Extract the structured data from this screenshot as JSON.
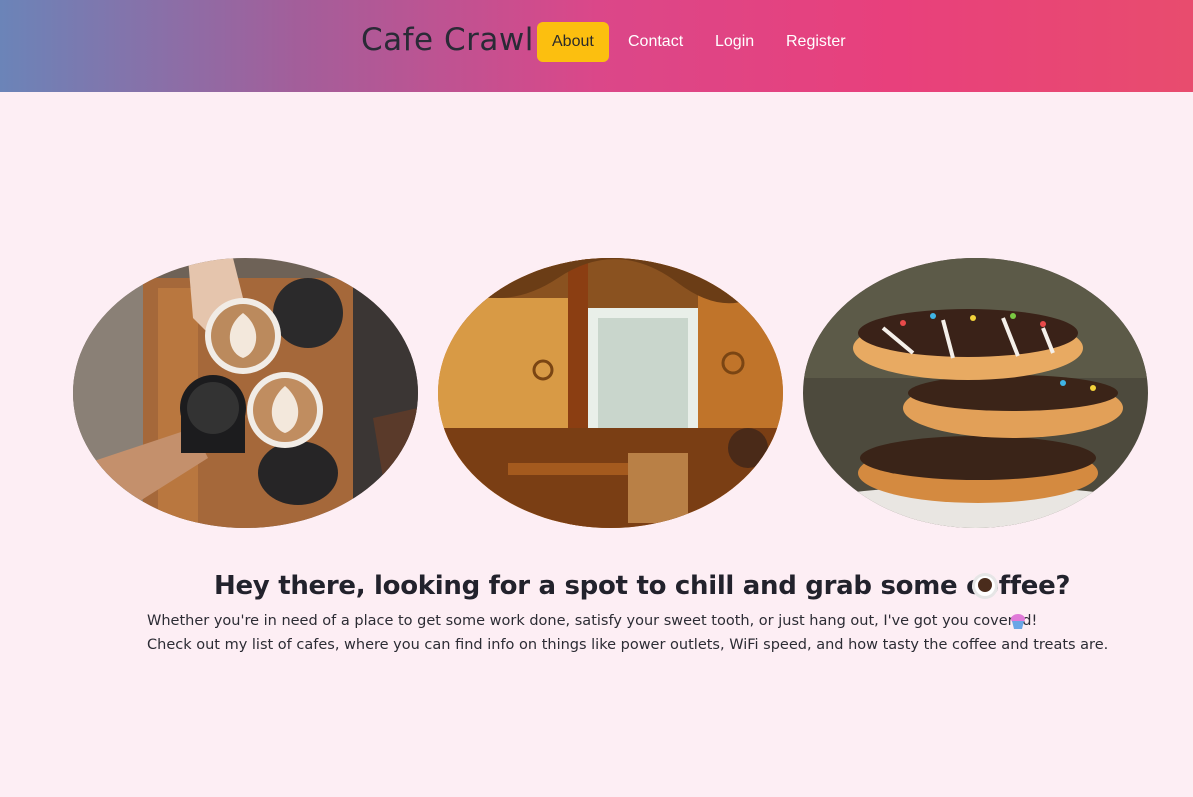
{
  "header": {
    "brand": "Cafe Crawl",
    "nav": [
      {
        "label": "About",
        "active": true
      },
      {
        "label": "Contact",
        "active": false
      },
      {
        "label": "Login",
        "active": false
      },
      {
        "label": "Register",
        "active": false
      }
    ]
  },
  "gallery": [
    {
      "subject": "coffee-cheers-photo"
    },
    {
      "subject": "cafe-interior-photo"
    },
    {
      "subject": "stacked-donuts-photo"
    }
  ],
  "intro": {
    "headline": "Hey there, looking for a spot to chill and grab some coffee?",
    "line1": "Whether you're in need of a place to get some work done, satisfy your sweet tooth, or just hang out, I've got you covered!",
    "line2": "Check out my list of cafes, where you can find info on things like power outlets, WiFi speed, and how tasty the coffee and treats are."
  },
  "icons": [
    "coffee-cup-icon",
    "cupcake-icon"
  ],
  "colors": {
    "page_bg": "#fdeef4",
    "active_nav": "#fcbf0f",
    "header_gradient": [
      "#6b84b8",
      "#db4789",
      "#e84c6e"
    ]
  }
}
